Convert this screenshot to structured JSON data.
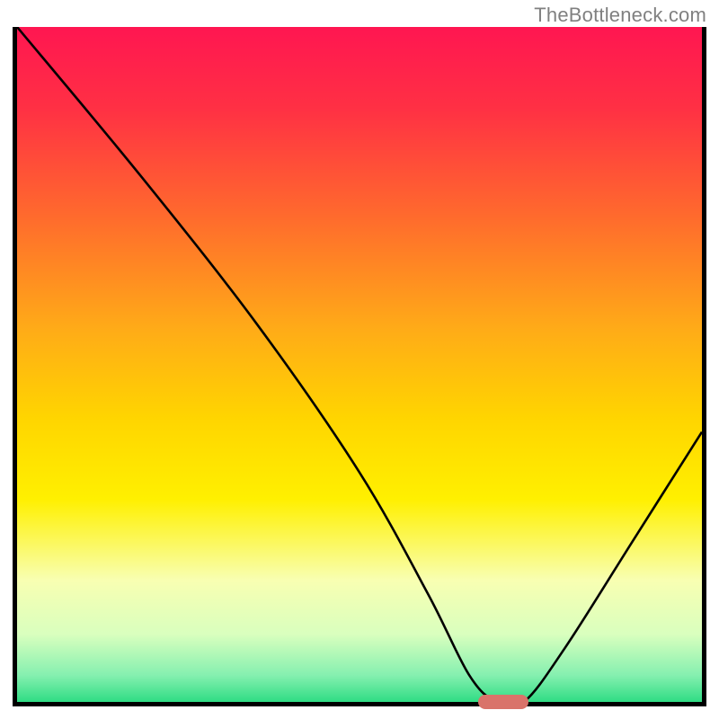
{
  "watermark": "TheBottleneck.com",
  "chart_data": {
    "type": "line",
    "title": "",
    "xlabel": "",
    "ylabel": "",
    "xlim": [
      0,
      100
    ],
    "ylim": [
      0,
      100
    ],
    "series": [
      {
        "name": "bottleneck-curve",
        "x": [
          0,
          18,
          35,
          50,
          60,
          66,
          70,
          74,
          80,
          90,
          100
        ],
        "values": [
          100,
          78,
          56,
          34,
          16,
          4,
          0,
          0,
          8,
          24,
          40
        ]
      }
    ],
    "marker": {
      "x": 71,
      "y": 0,
      "width_pct": 7.3
    },
    "background_gradient": {
      "stops": [
        {
          "pct": 0,
          "color": "#ff1651"
        },
        {
          "pct": 12,
          "color": "#ff3044"
        },
        {
          "pct": 28,
          "color": "#ff6a2d"
        },
        {
          "pct": 45,
          "color": "#ffac17"
        },
        {
          "pct": 58,
          "color": "#ffd500"
        },
        {
          "pct": 70,
          "color": "#fff000"
        },
        {
          "pct": 82,
          "color": "#f8ffb2"
        },
        {
          "pct": 90,
          "color": "#d9ffbe"
        },
        {
          "pct": 96,
          "color": "#86f0b0"
        },
        {
          "pct": 100,
          "color": "#2fdc84"
        }
      ]
    }
  }
}
